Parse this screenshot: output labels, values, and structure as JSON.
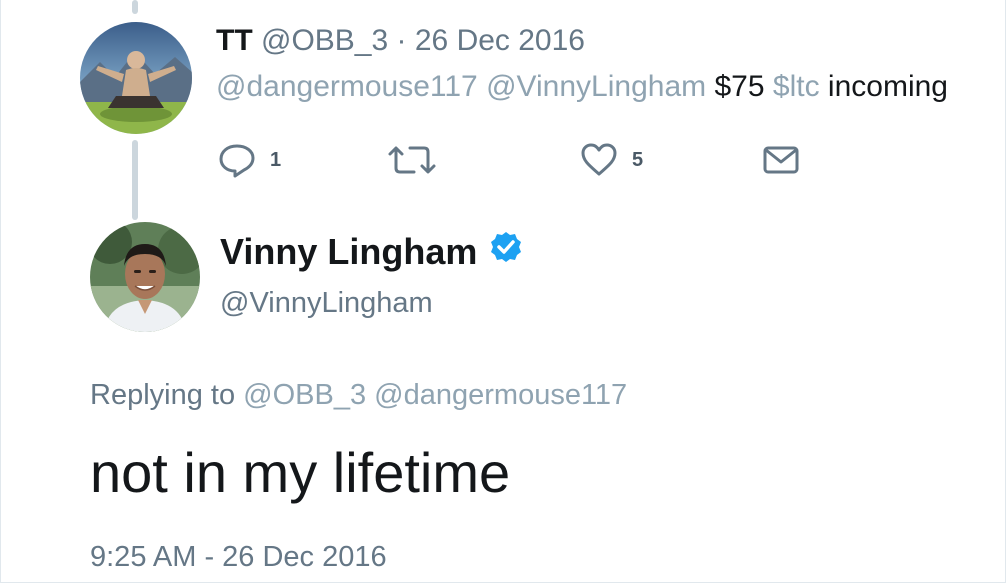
{
  "parent_tweet": {
    "display_name": "TT",
    "handle": "@OBB_3",
    "separator": " · ",
    "date": "26 Dec 2016",
    "text": {
      "mention1": "@dangermouse117",
      "mention2": "@VinnyLingham",
      "price": "$75",
      "cashtag": "$ltc",
      "tail": "incoming"
    },
    "actions": {
      "reply_icon": "reply-icon",
      "reply_count": "1",
      "retweet_icon": "retweet-icon",
      "like_icon": "heart-icon",
      "like_count": "5",
      "dm_icon": "envelope-icon"
    }
  },
  "main_tweet": {
    "display_name": "Vinny Lingham",
    "verified_icon": "verified-badge-icon",
    "handle": "@VinnyLingham",
    "replying_prefix": "Replying to",
    "replying_mention1": "@OBB_3",
    "replying_mention2": "@dangermouse117",
    "text": "not in my lifetime",
    "timestamp": "9:25 AM - 26 Dec 2016"
  },
  "colors": {
    "text_primary": "#14171a",
    "text_secondary": "#657786",
    "link_muted": "#8fa3b1",
    "verified_blue": "#1da1f2",
    "thread_line": "#ccd6dd"
  }
}
